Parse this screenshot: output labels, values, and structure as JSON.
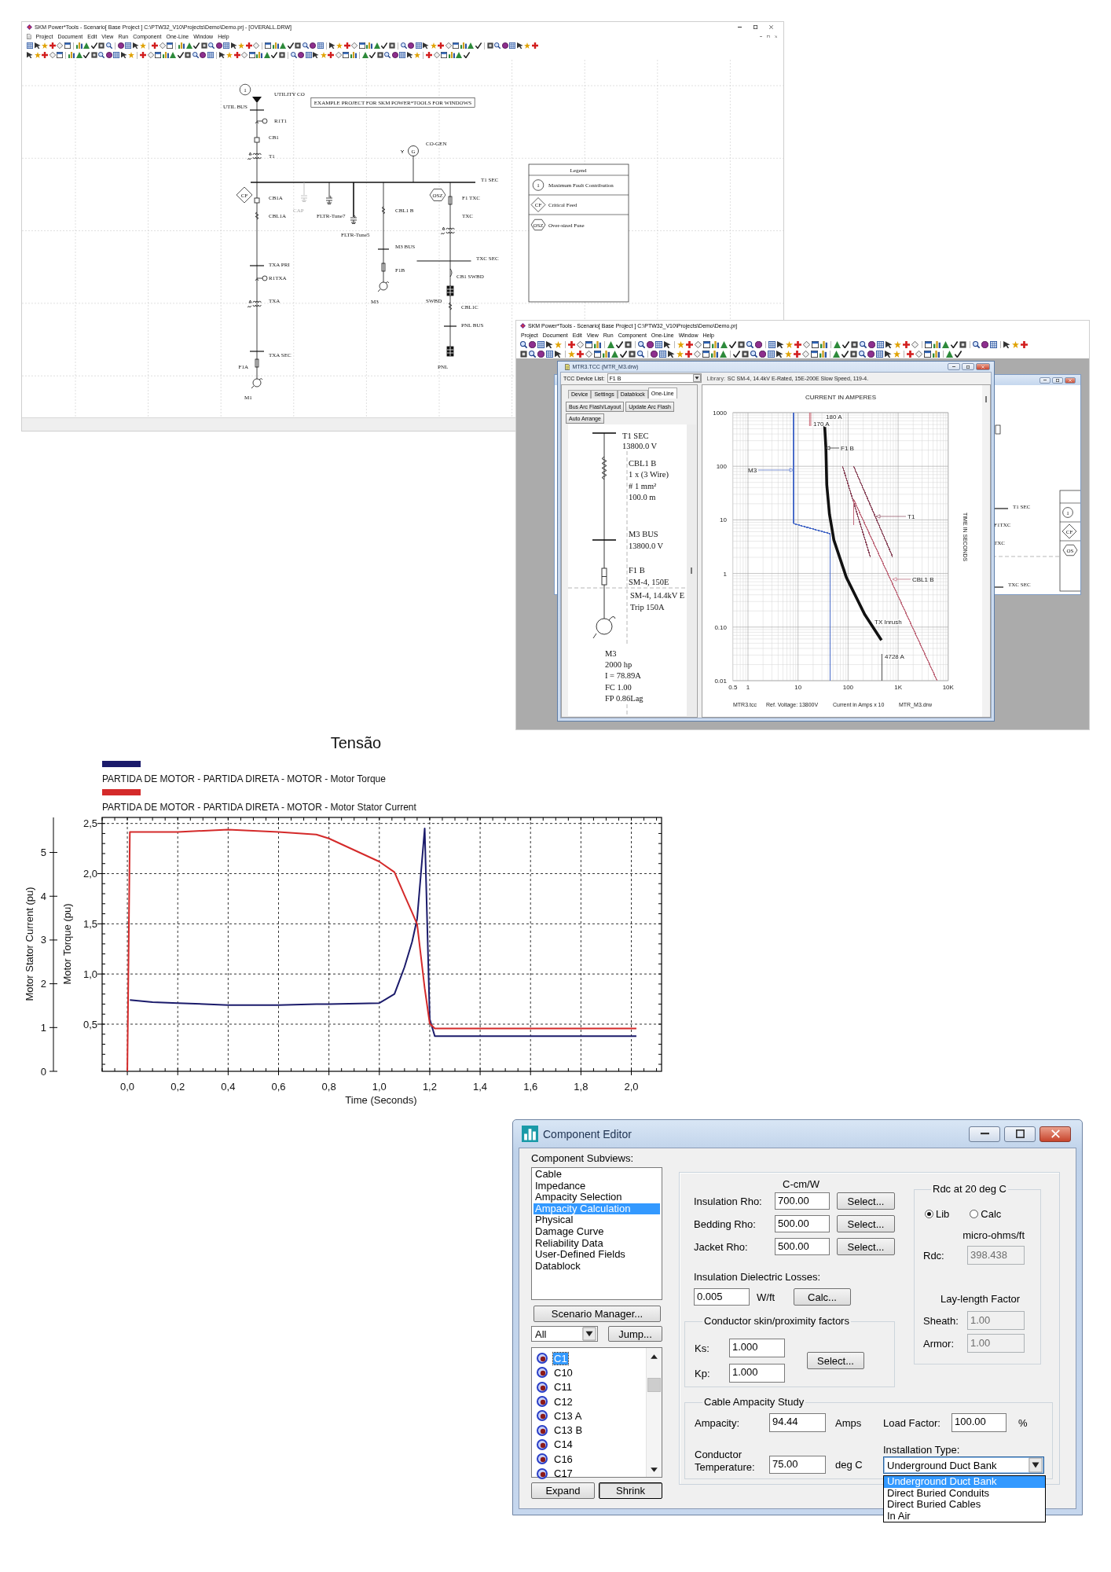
{
  "one_line_window": {
    "title": "SKM Power*Tools - Scenario[ Base Project ] C:\\PTW32_V10\\Projects\\Demo\\Demo.prj - [OVERALL.DRW]",
    "menu": [
      "Project",
      "Document",
      "Edit",
      "View",
      "Run",
      "Component",
      "One-Line",
      "Window",
      "Help"
    ],
    "diagram": {
      "note": "EXAMPLE PROJECT FOR SKM POWER*TOOLS FOR WINDOWS",
      "markers": [
        {
          "kind": "circle",
          "text": "1"
        },
        {
          "kind": "diamond",
          "text": "CF"
        },
        {
          "kind": "hexagon",
          "text": "OSZ"
        }
      ],
      "nodes": [
        {
          "kind": "source",
          "label": "UTILITY CO",
          "disabled": false
        },
        {
          "kind": "bus",
          "label": "UTIL BUS",
          "disabled": false
        },
        {
          "kind": "relay",
          "label": "R1T1",
          "disabled": false
        },
        {
          "kind": "breaker",
          "label": "CB1",
          "disabled": false
        },
        {
          "kind": "transformer",
          "label": "T1",
          "disabled": false
        },
        {
          "kind": "bus",
          "label": "T1 SEC",
          "disabled": false
        },
        {
          "kind": "breaker",
          "label": "CB1A",
          "disabled": false
        },
        {
          "kind": "cable",
          "label": "CBL1A",
          "disabled": false
        },
        {
          "kind": "capacitor",
          "label": "CAP",
          "disabled": true
        },
        {
          "kind": "filter",
          "label": "FLTR-Tune7",
          "disabled": false
        },
        {
          "kind": "filter",
          "label": "FLTR-Tune5",
          "disabled": false
        },
        {
          "kind": "cable",
          "label": "CBL1 B",
          "disabled": false
        },
        {
          "kind": "bus",
          "label": "M3 BUS",
          "disabled": false
        },
        {
          "kind": "fuse",
          "label": "F1B",
          "disabled": false
        },
        {
          "kind": "motor",
          "label": "M3",
          "disabled": false
        },
        {
          "kind": "generator",
          "label": "CO-GEN",
          "symbol": "G",
          "disabled": false
        },
        {
          "kind": "fuse",
          "label": "F1 TXC",
          "disabled": false
        },
        {
          "kind": "transformer",
          "label": "TXC",
          "disabled": false
        },
        {
          "kind": "bus",
          "label": "TXC SEC",
          "disabled": false
        },
        {
          "kind": "switch",
          "label": "CB1 SWBD",
          "disabled": false
        },
        {
          "kind": "switchboard",
          "label": "SWBD",
          "disabled": false
        },
        {
          "kind": "cable",
          "label": "CBL1C",
          "disabled": false
        },
        {
          "kind": "bus",
          "label": "PNL BUS",
          "disabled": false
        },
        {
          "kind": "switchboard",
          "label": "PNL",
          "disabled": false
        },
        {
          "kind": "bus",
          "label": "TXA PRI",
          "disabled": false
        },
        {
          "kind": "relay",
          "label": "R1TXA",
          "disabled": false
        },
        {
          "kind": "transformer",
          "label": "TXA",
          "disabled": false
        },
        {
          "kind": "bus",
          "label": "TXA SEC",
          "disabled": false
        },
        {
          "kind": "fuse",
          "label": "F1A",
          "disabled": false
        },
        {
          "kind": "motor",
          "label": "M1",
          "disabled": false
        }
      ],
      "legend": {
        "title": "Legend",
        "items": [
          {
            "kind": "circle",
            "text": "1",
            "label": "Maximum Fault Contribution"
          },
          {
            "kind": "diamond",
            "text": "CF",
            "label": "Critical Feed"
          },
          {
            "kind": "hexagon",
            "text": "OSZ",
            "label": "Over-sized Fuse"
          }
        ]
      }
    }
  },
  "tcc_window": {
    "title": "SKM Power*Tools - Scenario[ Base Project ] C:\\PTW32_V10\\Projects\\Demo\\Demo.prj",
    "menu": [
      "Project",
      "Document",
      "Edit",
      "View",
      "Run",
      "Component",
      "One-Line",
      "Window",
      "Help"
    ],
    "background_window": {
      "labels": [
        "T1 SEC",
        "F1TXC",
        "TXC",
        "TXC SEC"
      ],
      "markers": [
        {
          "kind": "circle",
          "text": "1"
        },
        {
          "kind": "diamond",
          "text": "CF"
        },
        {
          "kind": "hexagon",
          "text": "OS"
        }
      ]
    },
    "tcc": {
      "title": "MTR3.TCC (MTR_M3.drw)",
      "device_list": {
        "label": "TCC Device List:",
        "value": "F1 B"
      },
      "library": {
        "label": "Library:",
        "value": "SC SM-4, 14.4kV E-Rated, 15E-200E Slow Speed, 119-4."
      },
      "tabs": [
        {
          "label": "Device",
          "selected": false
        },
        {
          "label": "Settings",
          "selected": false
        },
        {
          "label": "Datablock",
          "selected": false
        },
        {
          "label": "One-Line",
          "selected": true
        }
      ],
      "buttons": [
        "Bus Arc Flash/Layout",
        "Update Arc Flash",
        "Auto Arrange"
      ],
      "device_labels": [
        {
          "lines": [
            "T1 SEC",
            "13800.0 V"
          ]
        },
        {
          "lines": [
            "CBL1 B",
            "1 x (3 Wire)",
            "# 1 mm²",
            "100.0 m"
          ]
        },
        {
          "lines": [
            "M3 BUS",
            "13800.0 V"
          ]
        },
        {
          "lines": [
            "F1 B",
            "SM-4, 150E"
          ]
        },
        {
          "lines": [
            "SM-4, 14.4kV E",
            "Trip 150A"
          ]
        },
        {
          "lines": [
            "M3",
            "2000 hp",
            "I = 78.89A",
            "FC 1.00",
            "FP 0.86Lag"
          ]
        }
      ],
      "plot": {
        "xlabel": "CURRENT IN AMPERES",
        "ylabel": "TIME IN SECONDS",
        "x_tick_labels": [
          "0.5",
          "1",
          "10",
          "100",
          "1K",
          "10K"
        ],
        "y_tick_labels": [
          "1000",
          "100",
          "10",
          "1",
          "0.10",
          "0.01"
        ],
        "curves": [
          {
            "label": "M3",
            "color": "#4a6cc8"
          },
          {
            "label": "F1 B",
            "color": "#111111"
          },
          {
            "label": "T1",
            "color": "#8c4a5e"
          },
          {
            "label": "CBL1 B",
            "color": "#c06a7c"
          }
        ],
        "annotations": [
          "180 A",
          "170 A",
          "TX Inrush",
          "4728 A"
        ]
      },
      "footer": [
        "MTR3.tcc",
        "Ref. Voltage: 13800V",
        "Current in Amps x 10",
        "MTR_M3.drw"
      ]
    }
  },
  "motor_start_chart": {
    "chart_data": {
      "type": "line",
      "title": "Tensão",
      "xlabel": "Time (Seconds)",
      "ylabel": "Motor Torque (pu)",
      "y2label": "Motor Stator Current (pu)",
      "grid": true,
      "legend": "top",
      "xlim": [
        -0.1,
        2.12
      ],
      "ylim": [
        0.03,
        2.56
      ],
      "y2lim": [
        0,
        5.8
      ],
      "xticks": [
        {
          "value": 0,
          "label": "0,0"
        },
        {
          "value": 0.2,
          "label": "0,2"
        },
        {
          "value": 0.4,
          "label": "0,4"
        },
        {
          "value": 0.6,
          "label": "0,6"
        },
        {
          "value": 0.8,
          "label": "0,8"
        },
        {
          "value": 1,
          "label": "1,0"
        },
        {
          "value": 1.2,
          "label": "1,2"
        },
        {
          "value": 1.4,
          "label": "1,4"
        },
        {
          "value": 1.6,
          "label": "1,6"
        },
        {
          "value": 1.8,
          "label": "1,8"
        },
        {
          "value": 2,
          "label": "2,0"
        }
      ],
      "yticks": [
        {
          "value": 0.5,
          "label": "0,5"
        },
        {
          "value": 1,
          "label": "1,0"
        },
        {
          "value": 1.5,
          "label": "1,5"
        },
        {
          "value": 2,
          "label": "2,0"
        },
        {
          "value": 2.5,
          "label": "2,5"
        }
      ],
      "y2ticks": [
        0,
        1,
        2,
        3,
        4,
        5
      ],
      "x": [
        0,
        0.01,
        0.1,
        0.2,
        0.4,
        0.6,
        0.75,
        0.8,
        1.0,
        1.06,
        1.1,
        1.13,
        1.15,
        1.18,
        1.2,
        1.22,
        2.02
      ],
      "series": [
        {
          "name": "PARTIDA DE MOTOR - PARTIDA DIRETA - MOTOR - Motor Torque",
          "color": "#1b1b6b",
          "axis": "y",
          "values": [
            null,
            0.74,
            0.72,
            0.71,
            0.69,
            0.69,
            0.7,
            0.7,
            0.71,
            0.8,
            1.07,
            1.32,
            1.55,
            2.45,
            0.55,
            0.38,
            0.38
          ]
        },
        {
          "name": "PARTIDA DE MOTOR - PARTIDA DIRETA - MOTOR - Motor Stator Current",
          "color": "#d42a2a",
          "axis": "y2",
          "values": [
            0,
            5.47,
            5.47,
            5.47,
            5.52,
            5.47,
            5.41,
            5.32,
            4.79,
            4.55,
            4.02,
            3.63,
            3.36,
            1.9,
            1.09,
            0.98,
            0.98
          ]
        }
      ]
    }
  },
  "component_editor": {
    "title": "Component Editor",
    "subviews_label": "Component Subviews:",
    "subviews": [
      {
        "label": "Cable",
        "selected": false
      },
      {
        "label": "Impedance",
        "selected": false
      },
      {
        "label": "Ampacity Selection",
        "selected": false
      },
      {
        "label": "Ampacity Calculation",
        "selected": true
      },
      {
        "label": "Physical",
        "selected": false
      },
      {
        "label": "Damage Curve",
        "selected": false
      },
      {
        "label": "Reliability Data",
        "selected": false
      },
      {
        "label": "User-Defined Fields",
        "selected": false
      },
      {
        "label": "Datablock",
        "selected": false
      }
    ],
    "scenario_button": "Scenario Manager...",
    "filter": {
      "value": "All"
    },
    "jump_button": "Jump...",
    "components": [
      {
        "label": "C1",
        "selected": true
      },
      {
        "label": "C10",
        "selected": false
      },
      {
        "label": "C11",
        "selected": false
      },
      {
        "label": "C12",
        "selected": false
      },
      {
        "label": "C13 A",
        "selected": false
      },
      {
        "label": "C13 B",
        "selected": false
      },
      {
        "label": "C14",
        "selected": false
      },
      {
        "label": "C16",
        "selected": false
      },
      {
        "label": "C17",
        "selected": false
      }
    ],
    "toggle_buttons": [
      {
        "label": "Expand",
        "pressed": false
      },
      {
        "label": "Shrink",
        "pressed": true
      }
    ],
    "unit_header": "C-cm/W",
    "rho_fields": [
      {
        "label": "Insulation Rho:",
        "value": "700.00",
        "button": "Select..."
      },
      {
        "label": "Bedding Rho:",
        "value": "500.00",
        "button": "Select..."
      },
      {
        "label": "Jacket Rho:",
        "value": "500.00",
        "button": "Select..."
      }
    ],
    "dielectric": {
      "label": "Insulation Dielectric Losses:",
      "value": "0.005",
      "unit": "W/ft",
      "button": "Calc..."
    },
    "skin_group": {
      "title": "Conductor skin/proximity factors",
      "fields": [
        {
          "label": "Ks:",
          "value": "1.000"
        },
        {
          "label": "Kp:",
          "value": "1.000"
        }
      ],
      "button": "Select..."
    },
    "rdc_group": {
      "title": "Rdc at 20 deg C",
      "options": [
        {
          "label": "Lib",
          "selected": true
        },
        {
          "label": "Calc",
          "selected": false
        }
      ],
      "unit": "micro-ohms/ft",
      "rdc": {
        "label": "Rdc:",
        "value": "398.438",
        "disabled": true
      },
      "lay_length_title": "Lay-length Factor",
      "factors": [
        {
          "label": "Sheath:",
          "value": "1.00",
          "disabled": true
        },
        {
          "label": "Armor:",
          "value": "1.00",
          "disabled": true
        }
      ]
    },
    "ampacity_group": {
      "title": "Cable Ampacity Study",
      "ampacity": {
        "label": "Ampacity:",
        "value": "94.44",
        "unit": "Amps"
      },
      "load_factor": {
        "label": "Load Factor:",
        "value": "100.00",
        "unit": "%"
      },
      "temperature": {
        "label": "Conductor Temperature:",
        "value": "75.00",
        "unit": "deg C"
      },
      "installation": {
        "label": "Installation Type:",
        "value": "Underground Duct Bank",
        "expanded": true,
        "options": [
          {
            "label": "Underground Duct Bank",
            "selected": true
          },
          {
            "label": "Direct Buried Conduits",
            "selected": false
          },
          {
            "label": "Direct Buried Cables",
            "selected": false
          },
          {
            "label": "In Air",
            "selected": false
          }
        ]
      }
    }
  }
}
